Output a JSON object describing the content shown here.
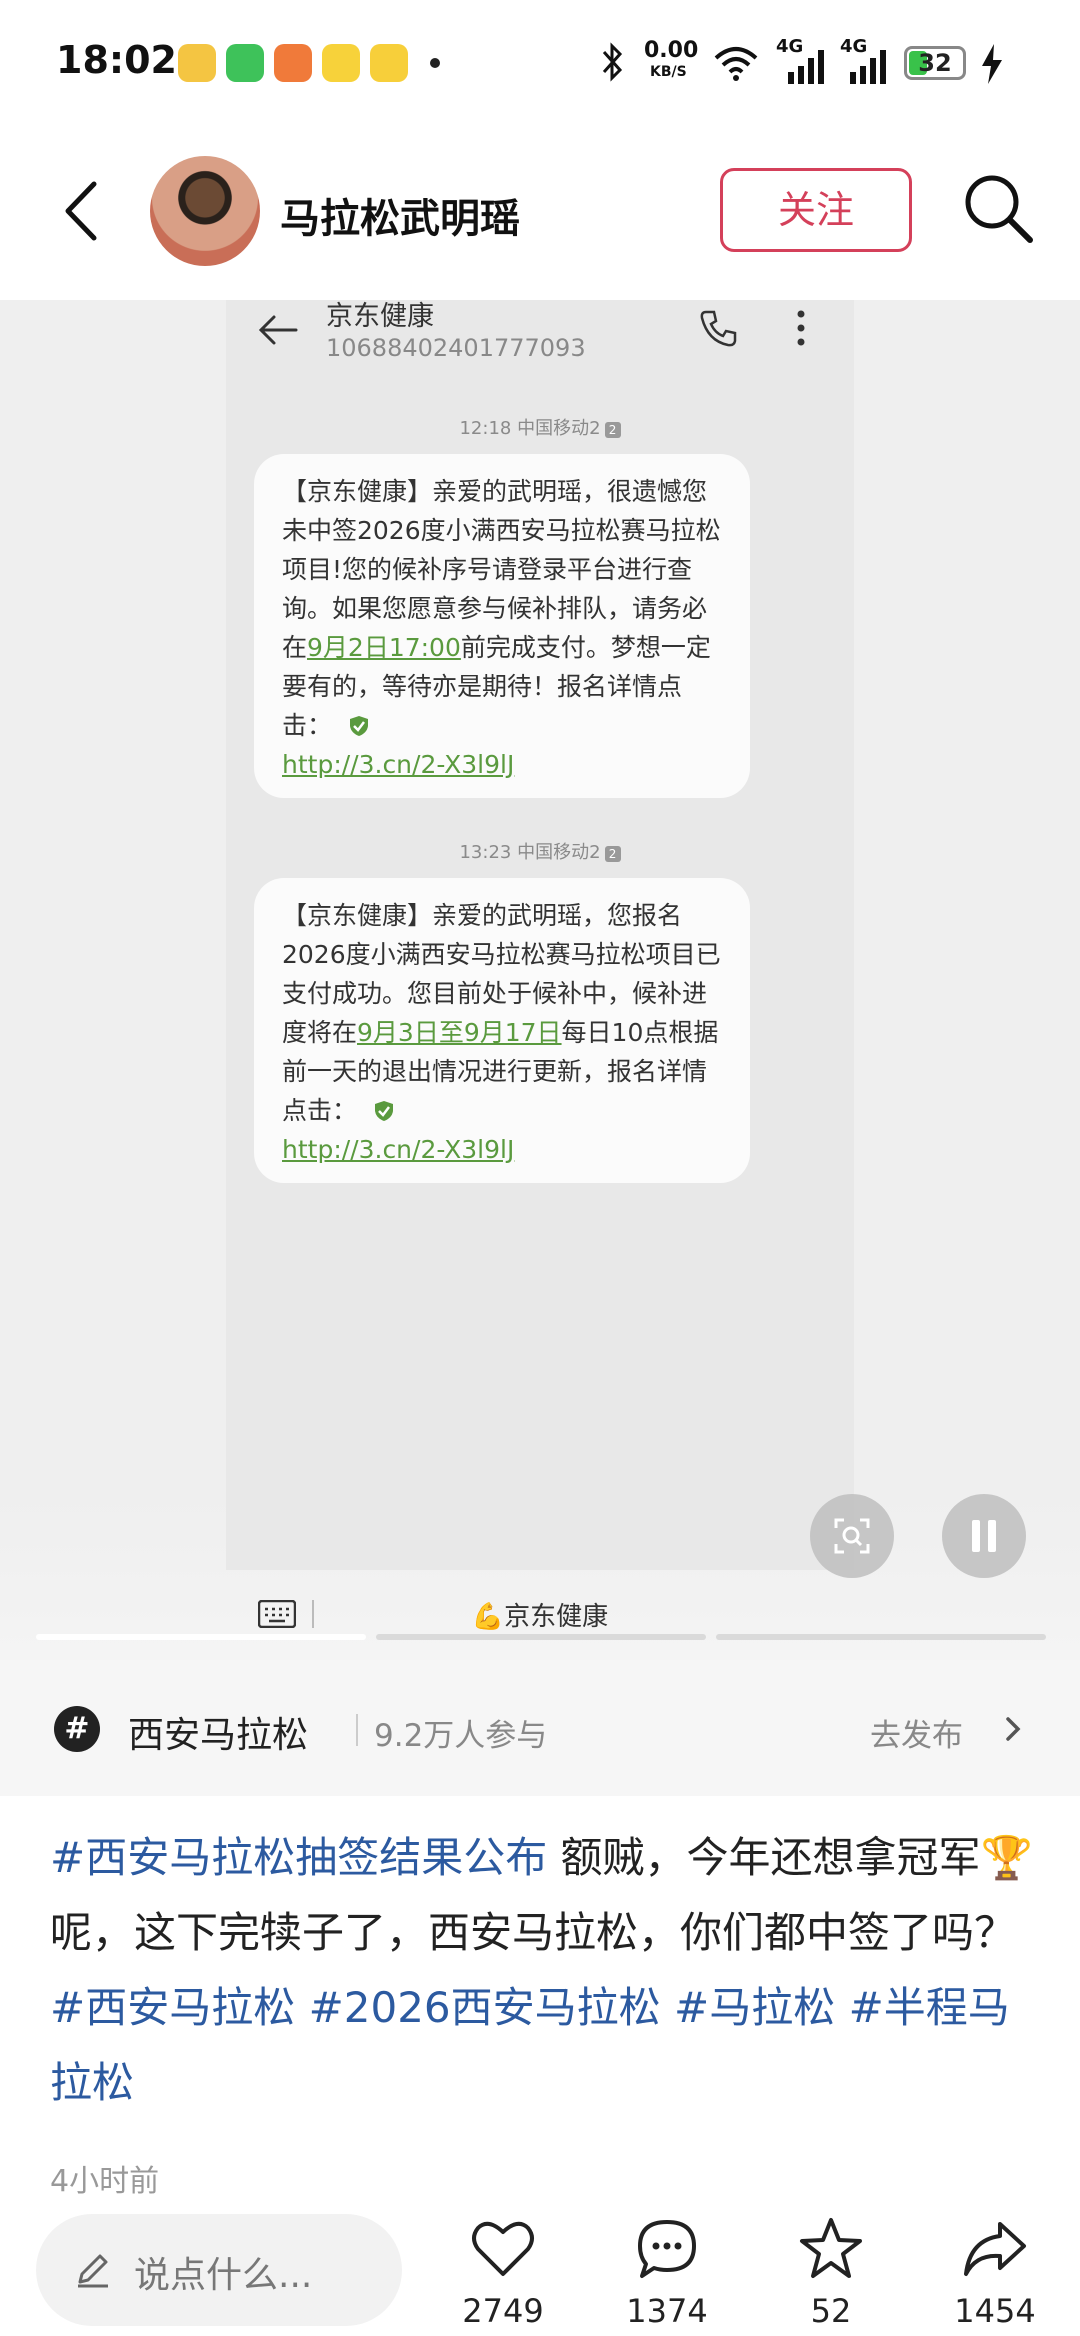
{
  "status_bar": {
    "time": "18:02",
    "net_speed_value": "0.00",
    "net_speed_unit": "KB/S",
    "signal1": "4G",
    "signal2": "4G",
    "battery": "32"
  },
  "header": {
    "username": "马拉松武明瑶",
    "follow_label": "关注"
  },
  "media": {
    "sms_contact": "京东健康",
    "sms_number": "10688402401777093",
    "messages": [
      {
        "time": "12:18",
        "carrier": "中国移动2",
        "sim": "2",
        "part1": "【京东健康】亲爱的武明瑶，很遗憾您未中签2026度小满西安马拉松赛马拉松项目!您的候补序号请登录平台进行查询。如果您愿意参与候补排队，请务必在",
        "link_date": "9月2日17:00",
        "part2": "前完成支付。梦想一定要有的，等待亦是期待！报名详情点击：",
        "url": "http://3.cn/2-X3l9lJ"
      },
      {
        "time": "13:23",
        "carrier": "中国移动2",
        "sim": "2",
        "part1": "【京东健康】亲爱的武明瑶，您报名2026度小满西安马拉松赛马拉松项目已支付成功。您目前处于候补中，候补进度将在",
        "link_date": "9月3日至9月17日",
        "part2": "每日10点根据前一天的退出情况进行更新，报名详情点击：",
        "url": "http://3.cn/2-X3l9lJ"
      }
    ],
    "source_label": "💪京东健康"
  },
  "topic": {
    "icon": "#",
    "name": "西安马拉松",
    "count": "9.2万人参与",
    "publish": "去发布"
  },
  "post": {
    "tag1": "#西安马拉松抽签结果公布",
    "text1": " 额贼，今年还想拿冠军🏆呢，这下完犊子了，西安马拉松，你们都中签了吗？",
    "tag2": "#西安马拉松",
    "tag3": "#2026西安马拉松",
    "tag4": "#马拉松",
    "tag5": "#半程马拉松",
    "time": "4小时前"
  },
  "bottom_bar": {
    "comment_placeholder": "说点什么...",
    "likes": "2749",
    "comments": "1374",
    "favorites": "52",
    "shares": "1454"
  },
  "colors": {
    "accent": "#d4405a",
    "tag": "#2c5aa0",
    "sms_link": "#5a9a3e"
  }
}
